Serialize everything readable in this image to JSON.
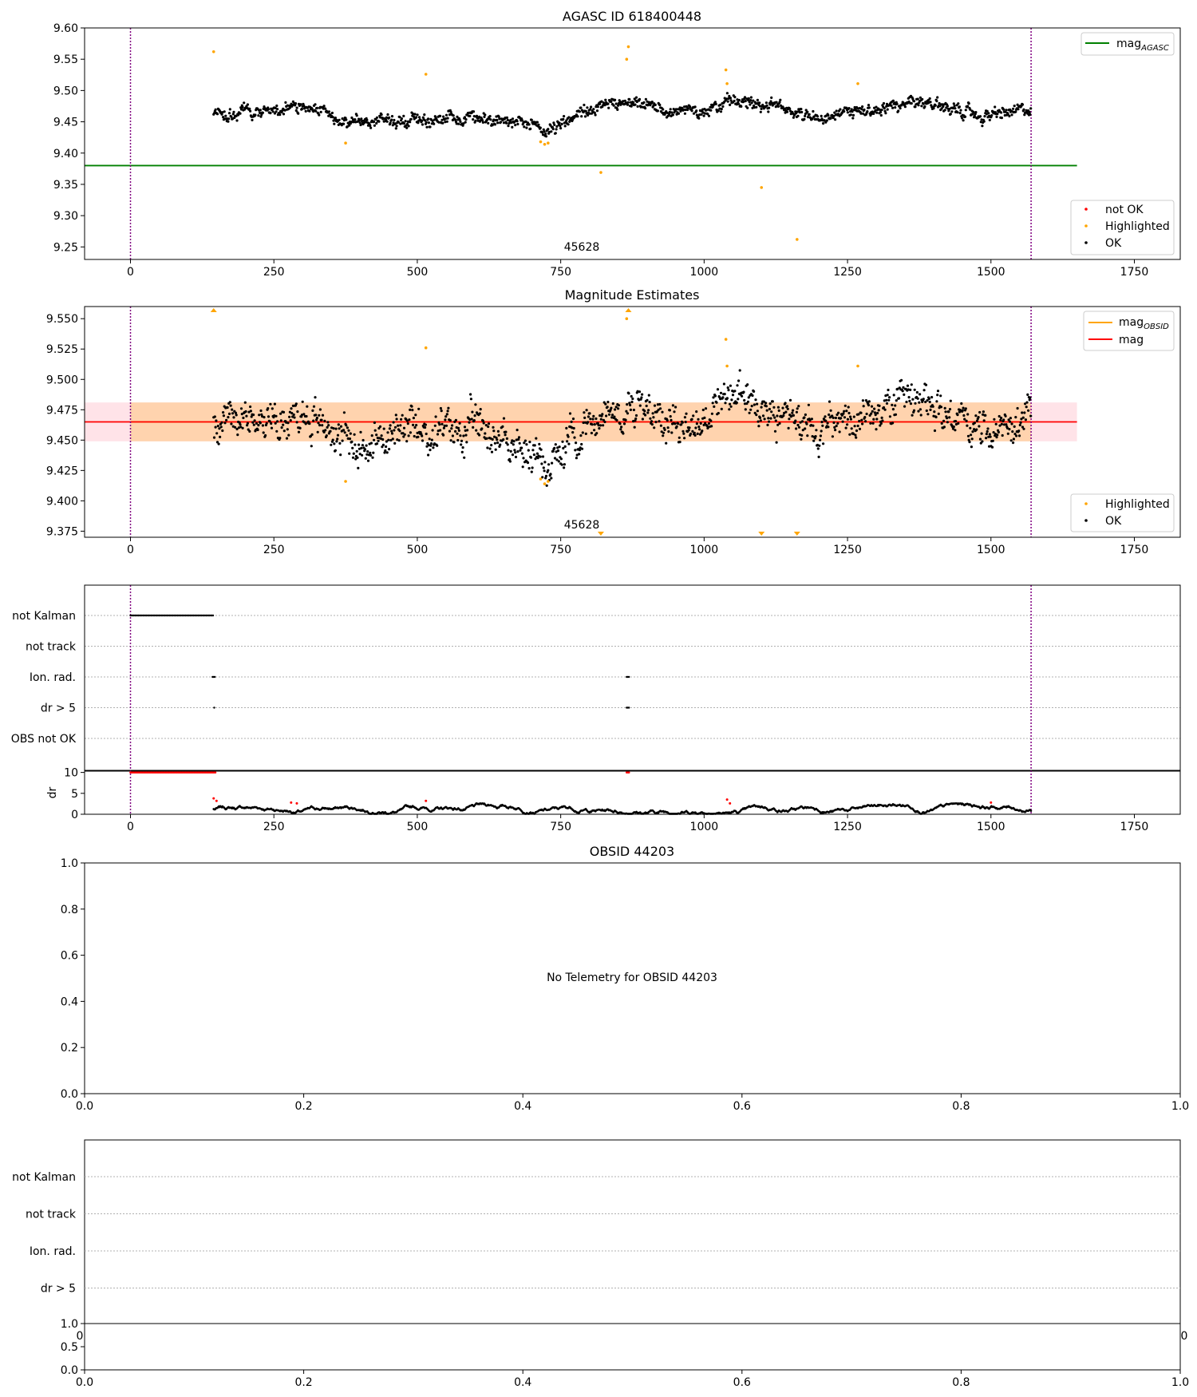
{
  "chart_data": [
    {
      "id": "p1",
      "type": "scatter",
      "title": "AGASC ID 618400448",
      "xlim": [
        -80,
        1830
      ],
      "ylim": [
        9.23,
        9.6
      ],
      "xticks": [
        "0",
        "250",
        "500",
        "750",
        "1000",
        "1250",
        "1500",
        "1750"
      ],
      "yticks": [
        "9.25",
        "9.30",
        "9.35",
        "9.40",
        "9.45",
        "9.50",
        "9.55",
        "9.60"
      ],
      "annotation": "45628",
      "vlines_x": [
        0,
        1570
      ],
      "series": [
        {
          "name": "mag_AGASC",
          "label": "mag",
          "label_sub": "AGASC",
          "kind": "hline",
          "y": 9.38,
          "x": [
            -80,
            1650
          ],
          "color": "#008000"
        },
        {
          "name": "OK",
          "kind": "points",
          "color": "#000000",
          "x_range": [
            145,
            1570
          ],
          "trend": [
            [
              145,
              9.462
            ],
            [
              300,
              9.472
            ],
            [
              400,
              9.448
            ],
            [
              500,
              9.455
            ],
            [
              620,
              9.46
            ],
            [
              720,
              9.435
            ],
            [
              820,
              9.475
            ],
            [
              900,
              9.475
            ],
            [
              980,
              9.465
            ],
            [
              1060,
              9.488
            ],
            [
              1100,
              9.48
            ],
            [
              1180,
              9.463
            ],
            [
              1260,
              9.462
            ],
            [
              1330,
              9.478
            ],
            [
              1440,
              9.472
            ],
            [
              1480,
              9.458
            ],
            [
              1570,
              9.468
            ]
          ],
          "scatter_amp": 0.014
        },
        {
          "name": "Highlighted",
          "kind": "points",
          "color": "#ffa500",
          "points": [
            [
              145,
              9.562
            ],
            [
              375,
              9.416
            ],
            [
              515,
              9.526
            ],
            [
              715,
              9.418
            ],
            [
              722,
              9.414
            ],
            [
              728,
              9.416
            ],
            [
              820,
              9.369
            ],
            [
              865,
              9.55
            ],
            [
              868,
              9.57
            ],
            [
              1038,
              9.533
            ],
            [
              1040,
              9.511
            ],
            [
              1100,
              9.345
            ],
            [
              1162,
              9.262
            ],
            [
              1268,
              9.511
            ]
          ]
        },
        {
          "name": "not OK",
          "kind": "points",
          "color": "#ff0000",
          "points": []
        }
      ],
      "legends": [
        {
          "position": "upper right",
          "entries": [
            {
              "label": "mag",
              "sub": "AGASC",
              "color": "#008000",
              "marker": "line"
            }
          ]
        },
        {
          "position": "lower right",
          "entries": [
            {
              "label": "not OK",
              "color": "#ff0000",
              "marker": "dot"
            },
            {
              "label": "Highlighted",
              "color": "#ffa500",
              "marker": "dot"
            },
            {
              "label": "OK",
              "color": "#000000",
              "marker": "dot"
            }
          ]
        }
      ]
    },
    {
      "id": "p2",
      "type": "scatter",
      "title": "Magnitude Estimates",
      "xlim": [
        -80,
        1830
      ],
      "ylim": [
        9.37,
        9.56
      ],
      "xticks": [
        "0",
        "250",
        "500",
        "750",
        "1000",
        "1250",
        "1500",
        "1750"
      ],
      "yticks": [
        "9.375",
        "9.400",
        "9.425",
        "9.450",
        "9.475",
        "9.500",
        "9.525",
        "9.550"
      ],
      "annotation": "45628",
      "vlines_x": [
        0,
        1570
      ],
      "bands": [
        {
          "name": "mag range",
          "y": [
            9.449,
            9.481
          ],
          "x": [
            -80,
            1650
          ],
          "color": "#ffc0cb",
          "opacity": 0.45
        },
        {
          "name": "mag_OBSID range",
          "y": [
            9.449,
            9.481
          ],
          "x": [
            0,
            1570
          ],
          "color": "#ffa500",
          "opacity": 0.25
        }
      ],
      "series": [
        {
          "name": "mag_OBSID",
          "label": "mag",
          "label_sub": "OBSID",
          "kind": "hline",
          "y": 9.465,
          "x": [
            0,
            1570
          ],
          "color": "#ffa500"
        },
        {
          "name": "mag",
          "label": "mag",
          "kind": "hline",
          "y": 9.465,
          "x": [
            -80,
            1650
          ],
          "color": "#ff0000"
        },
        {
          "name": "OK",
          "kind": "points",
          "color": "#000000",
          "x_range": [
            145,
            1570
          ],
          "trend": [
            [
              145,
              9.462
            ],
            [
              300,
              9.472
            ],
            [
              400,
              9.448
            ],
            [
              500,
              9.455
            ],
            [
              620,
              9.46
            ],
            [
              720,
              9.43
            ],
            [
              820,
              9.475
            ],
            [
              900,
              9.475
            ],
            [
              980,
              9.465
            ],
            [
              1060,
              9.488
            ],
            [
              1100,
              9.48
            ],
            [
              1180,
              9.463
            ],
            [
              1260,
              9.462
            ],
            [
              1330,
              9.478
            ],
            [
              1440,
              9.472
            ],
            [
              1480,
              9.455
            ],
            [
              1570,
              9.468
            ]
          ],
          "scatter_amp": 0.022
        },
        {
          "name": "Highlighted",
          "kind": "points",
          "color": "#ffa500",
          "points": [
            [
              375,
              9.416
            ],
            [
              515,
              9.526
            ],
            [
              715,
              9.418
            ],
            [
              722,
              9.414
            ],
            [
              728,
              9.416
            ],
            [
              865,
              9.55
            ],
            [
              1038,
              9.533
            ],
            [
              1040,
              9.511
            ],
            [
              1268,
              9.511
            ]
          ]
        },
        {
          "name": "Highlighted off-scale",
          "kind": "arrows",
          "color": "#ffa500",
          "points": [
            [
              145,
              "up"
            ],
            [
              868,
              "up"
            ],
            [
              820,
              "down"
            ],
            [
              1100,
              "down"
            ],
            [
              1162,
              "down"
            ]
          ]
        }
      ],
      "legends": [
        {
          "position": "upper right",
          "entries": [
            {
              "label": "mag",
              "sub": "OBSID",
              "color": "#ffa500",
              "marker": "line"
            },
            {
              "label": "mag",
              "color": "#ff0000",
              "marker": "line"
            }
          ]
        },
        {
          "position": "lower right",
          "entries": [
            {
              "label": "Highlighted",
              "color": "#ffa500",
              "marker": "dot"
            },
            {
              "label": "OK",
              "color": "#000000",
              "marker": "dot"
            }
          ]
        }
      ]
    },
    {
      "id": "p3",
      "type": "scatter",
      "title": "",
      "xlim": [
        -80,
        1830
      ],
      "xticks": [
        "0",
        "250",
        "500",
        "750",
        "1000",
        "1250",
        "1500",
        "1750"
      ],
      "vlines_x": [
        0,
        1570
      ],
      "flag_categories": [
        "not Kalman",
        "not track",
        "Ion. rad.",
        "dr > 5",
        "OBS not OK"
      ],
      "flags": [
        {
          "category": "not Kalman",
          "x": [
            0,
            145
          ],
          "color": "#000000"
        },
        {
          "category": "Ion. rad.",
          "x": [
            143,
            148
          ],
          "color": "#000000"
        },
        {
          "category": "Ion. rad.",
          "x": [
            865,
            870
          ],
          "color": "#000000"
        },
        {
          "category": "dr > 5",
          "x": [
            146,
            147
          ],
          "color": "#000000"
        },
        {
          "category": "dr > 5",
          "x": [
            865,
            870
          ],
          "color": "#000000"
        }
      ],
      "dr_panel": {
        "ylabel": "dr",
        "yticks": [
          "0",
          "5",
          "10"
        ],
        "ylim": [
          0,
          10.5
        ],
        "capped_red": [
          [
            0,
            148
          ],
          [
            865,
            870
          ]
        ],
        "red_points": [
          [
            145,
            3.8
          ],
          [
            150,
            3.2
          ],
          [
            280,
            2.8
          ],
          [
            290,
            2.6
          ],
          [
            515,
            3.2
          ],
          [
            1040,
            3.5
          ],
          [
            1045,
            2.6
          ],
          [
            1500,
            2.8
          ]
        ],
        "black_x_range": [
          145,
          1570
        ],
        "black_amp": 2.2
      }
    },
    {
      "id": "p4",
      "type": "scatter",
      "title": "OBSID 44203",
      "message": "No Telemetry for OBSID 44203",
      "xlim": [
        0,
        1
      ],
      "ylim": [
        0,
        1
      ],
      "xticks": [
        "0.0",
        "0.2",
        "0.4",
        "0.6",
        "0.8",
        "1.0"
      ],
      "yticks": [
        "0.0",
        "0.2",
        "0.4",
        "0.6",
        "0.8",
        "1.0"
      ]
    },
    {
      "id": "p5",
      "type": "scatter",
      "title": "",
      "flag_categories": [
        "not Kalman",
        "not track",
        "Ion. rad.",
        "dr > 5"
      ],
      "hidden_xticks": [
        "0",
        "0"
      ],
      "sub_panel": {
        "xlim": [
          0,
          1
        ],
        "ylim": [
          0,
          1
        ],
        "xticks": [
          "0.0",
          "0.2",
          "0.4",
          "0.6",
          "0.8",
          "1.0"
        ],
        "yticks": [
          "0.0",
          "0.5",
          "1.0"
        ]
      }
    }
  ],
  "colors": {
    "vline": "#800080",
    "grid": "#b0b0b0",
    "axes": "#000000"
  }
}
